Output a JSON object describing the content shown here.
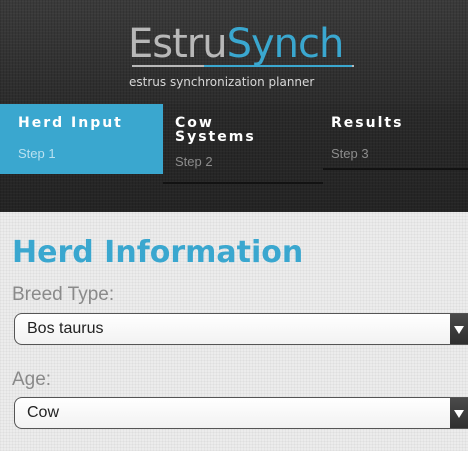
{
  "header": {
    "logo_part1": "Estru",
    "logo_part2": "Synch",
    "tagline": "estrus synchronization planner"
  },
  "steps": [
    {
      "title": "Herd Input",
      "subtitle": "Step 1",
      "active": true
    },
    {
      "title": "Cow Systems",
      "subtitle": "Step 2",
      "active": false
    },
    {
      "title": "Results",
      "subtitle": "Step 3",
      "active": false
    }
  ],
  "main": {
    "title": "Herd Information",
    "breed": {
      "label": "Breed Type:",
      "value": "Bos taurus"
    },
    "age": {
      "label": "Age:",
      "value": "Cow"
    }
  },
  "colors": {
    "accent": "#3aa7cf",
    "header_bg": "#333333",
    "content_bg": "#ececec"
  },
  "icons": {
    "select_arrow": "triangle-down-icon"
  }
}
